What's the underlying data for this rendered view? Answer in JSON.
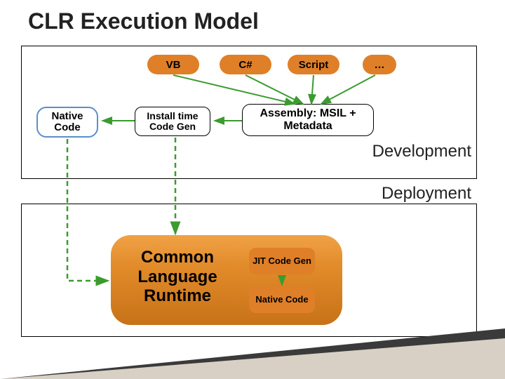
{
  "title": "CLR Execution Model",
  "langs": {
    "vb": "VB",
    "cs": "C#",
    "script": "Script",
    "dots": "…"
  },
  "native_code": "Native Code",
  "install_time": "Install time Code Gen",
  "assembly": "Assembly: MSIL + Metadata",
  "labels": {
    "development": "Development",
    "deployment": "Deployment"
  },
  "clr": "Common Language Runtime",
  "jit": "JIT Code Gen",
  "native_code2": "Native Code"
}
